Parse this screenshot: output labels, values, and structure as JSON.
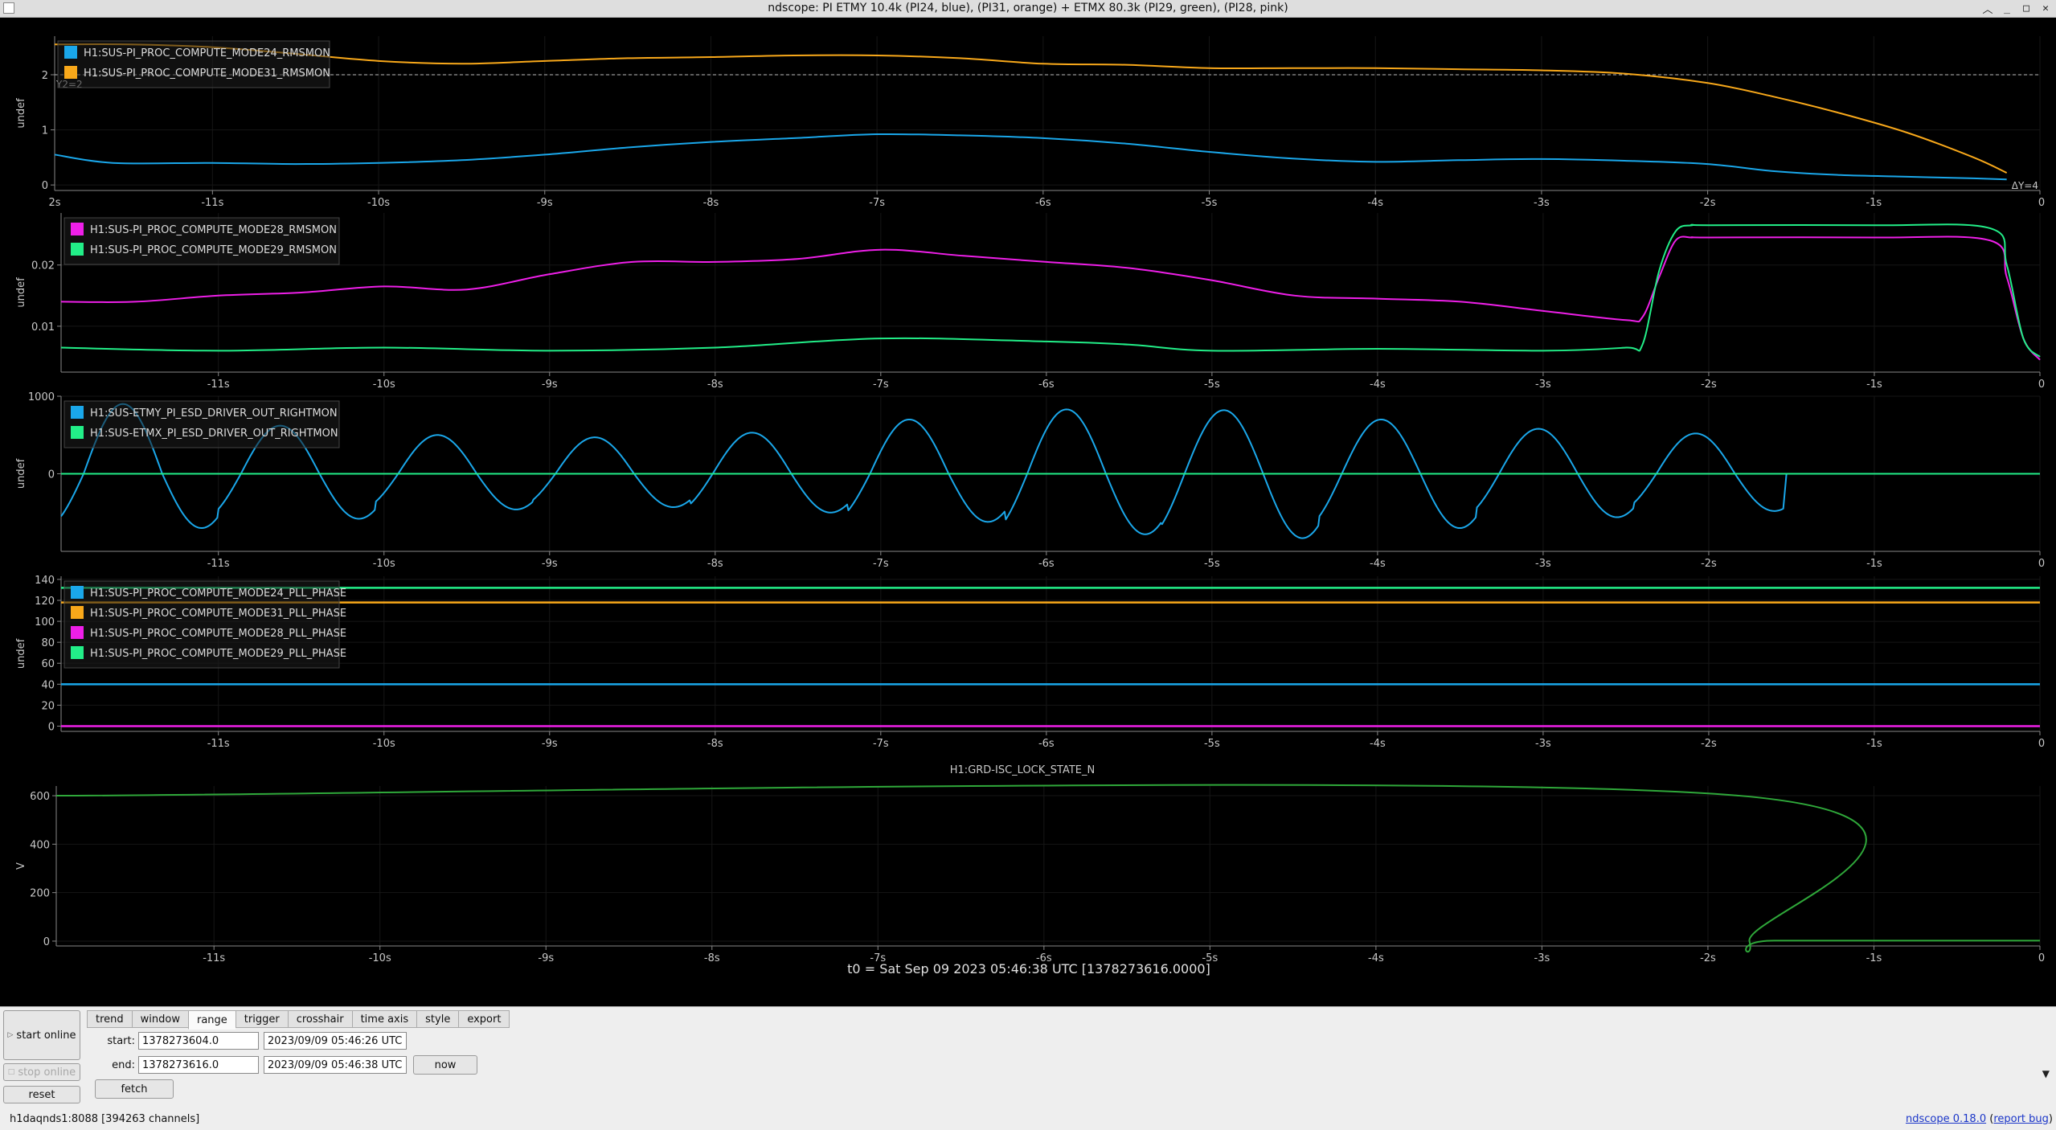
{
  "window": {
    "title": "ndscope: PI ETMY 10.4k (PI24, blue), (PI31, orange) + ETMX 80.3k (PI29, green), (PI28, pink)"
  },
  "colors": {
    "blue": "#1aa7ea",
    "orange": "#f8a81a",
    "pink": "#ee1fe8",
    "green": "#22ee88",
    "guardian": "#2fa83a",
    "background": "#000000",
    "axis_text": "#c8c8c8"
  },
  "x_axis": {
    "ticks": [
      -11,
      -10,
      -9,
      -8,
      -7,
      -6,
      -5,
      -4,
      -3,
      -2,
      -1,
      0
    ],
    "tick_labels": [
      "-11s",
      "-10s",
      "-9s",
      "-8s",
      "-7s",
      "-6s",
      "-5s",
      "-4s",
      "-3s",
      "-2s",
      "-1s",
      "0"
    ],
    "first_plot_left_label": "2s",
    "range": [
      -11.95,
      0
    ]
  },
  "t0_label": "t0 = Sat Sep 09 2023 05:46:38 UTC [1378273616.0000]",
  "chart_data": [
    {
      "type": "line",
      "ylabel": "undef",
      "yticks": [
        0,
        1,
        2
      ],
      "ylim": [
        -0.1,
        2.7
      ],
      "cursor_y": 2.0,
      "cursor_label": "Y2=2",
      "delta_label": "ΔY=4",
      "series": [
        {
          "name": "H1:SUS-PI_PROC_COMPUTE_MODE24_RMSMON",
          "color": "blue",
          "x": [
            -11.95,
            -11.6,
            -11.0,
            -10.5,
            -10.0,
            -9.5,
            -9.0,
            -8.5,
            -8.0,
            -7.5,
            -7.0,
            -6.5,
            -6.0,
            -5.5,
            -5.0,
            -4.5,
            -4.0,
            -3.5,
            -3.0,
            -2.5,
            -2.0,
            -1.6,
            -1.2,
            -0.8,
            -0.4,
            -0.2
          ],
          "y": [
            0.55,
            0.4,
            0.4,
            0.38,
            0.4,
            0.45,
            0.55,
            0.68,
            0.78,
            0.85,
            0.92,
            0.9,
            0.85,
            0.75,
            0.6,
            0.48,
            0.42,
            0.45,
            0.47,
            0.44,
            0.38,
            0.25,
            0.18,
            0.15,
            0.12,
            0.1
          ]
        },
        {
          "name": "H1:SUS-PI_PROC_COMPUTE_MODE31_RMSMON",
          "color": "orange",
          "x": [
            -11.95,
            -11.5,
            -11.0,
            -10.5,
            -10.0,
            -9.5,
            -9.0,
            -8.5,
            -8.0,
            -7.5,
            -7.0,
            -6.5,
            -6.0,
            -5.5,
            -5.0,
            -4.5,
            -4.0,
            -3.5,
            -3.0,
            -2.5,
            -2.0,
            -1.6,
            -1.2,
            -0.8,
            -0.4,
            -0.2
          ],
          "y": [
            2.55,
            2.55,
            2.5,
            2.38,
            2.25,
            2.2,
            2.25,
            2.3,
            2.32,
            2.35,
            2.35,
            2.3,
            2.2,
            2.18,
            2.12,
            2.12,
            2.12,
            2.1,
            2.08,
            2.02,
            1.85,
            1.6,
            1.3,
            0.95,
            0.5,
            0.22
          ]
        }
      ]
    },
    {
      "type": "line",
      "ylabel": "undef",
      "yticks": [
        0.01,
        0.02
      ],
      "ytick_labels": [
        "0.01",
        "0.02"
      ],
      "ylim": [
        0.0025,
        0.0285
      ],
      "series": [
        {
          "name": "H1:SUS-PI_PROC_COMPUTE_MODE28_RMSMON",
          "color": "pink",
          "x": [
            -11.95,
            -11.5,
            -11.0,
            -10.5,
            -10.0,
            -9.5,
            -9.0,
            -8.5,
            -8.0,
            -7.5,
            -7.0,
            -6.5,
            -6.0,
            -5.5,
            -5.0,
            -4.5,
            -4.0,
            -3.5,
            -3.0,
            -2.5,
            -2.4,
            -2.3,
            -2.2,
            -2.1,
            -2.0,
            -1.0,
            -0.3,
            -0.2,
            -0.1,
            0.0
          ],
          "y": [
            0.014,
            0.014,
            0.015,
            0.0155,
            0.0165,
            0.016,
            0.0185,
            0.0205,
            0.0205,
            0.021,
            0.0225,
            0.0215,
            0.0205,
            0.0195,
            0.0175,
            0.015,
            0.0145,
            0.014,
            0.0125,
            0.011,
            0.0115,
            0.018,
            0.024,
            0.0245,
            0.0245,
            0.0245,
            0.024,
            0.018,
            0.008,
            0.0045
          ]
        },
        {
          "name": "H1:SUS-PI_PROC_COMPUTE_MODE29_RMSMON",
          "color": "green",
          "x": [
            -11.95,
            -11.0,
            -10.0,
            -9.0,
            -8.0,
            -7.0,
            -6.0,
            -5.5,
            -5.0,
            -4.0,
            -3.0,
            -2.5,
            -2.4,
            -2.3,
            -2.2,
            -2.1,
            -2.0,
            -1.0,
            -0.3,
            -0.2,
            -0.1,
            0.0
          ],
          "y": [
            0.0065,
            0.006,
            0.0065,
            0.006,
            0.0065,
            0.008,
            0.0075,
            0.007,
            0.006,
            0.0063,
            0.006,
            0.0065,
            0.007,
            0.019,
            0.0255,
            0.0265,
            0.0265,
            0.0265,
            0.026,
            0.02,
            0.008,
            0.005
          ]
        }
      ]
    },
    {
      "type": "line",
      "ylabel": "undef",
      "yticks": [
        0,
        1000
      ],
      "ylim": [
        -1000,
        1000
      ],
      "series": [
        {
          "name": "H1:SUS-ETMY_PI_ESD_DRIVER_OUT_RIGHTMON",
          "color": "blue",
          "wave": {
            "start": -11.95,
            "end": -1.55,
            "oscillations": [
              {
                "peak": 900,
                "trough": -700
              },
              {
                "peak": 620,
                "trough": -580
              },
              {
                "peak": 500,
                "trough": -460
              },
              {
                "peak": 470,
                "trough": -430
              },
              {
                "peak": 530,
                "trough": -500
              },
              {
                "peak": 700,
                "trough": -620
              },
              {
                "peak": 830,
                "trough": -780
              },
              {
                "peak": 820,
                "trough": -830
              },
              {
                "peak": 700,
                "trough": -700
              },
              {
                "peak": 580,
                "trough": -560
              },
              {
                "peak": 520,
                "trough": -480
              }
            ]
          }
        },
        {
          "name": "H1:SUS-ETMX_PI_ESD_DRIVER_OUT_RIGHTMON",
          "color": "green",
          "x": [
            -11.95,
            0
          ],
          "y": [
            0,
            0
          ]
        }
      ]
    },
    {
      "type": "line",
      "ylabel": "undef",
      "yticks": [
        0,
        20,
        40,
        60,
        80,
        100,
        120,
        140
      ],
      "ylim": [
        -5,
        143
      ],
      "series": [
        {
          "name": "H1:SUS-PI_PROC_COMPUTE_MODE24_PLL_PHASE",
          "color": "blue",
          "x": [
            -11.95,
            0
          ],
          "y": [
            40,
            40
          ]
        },
        {
          "name": "H1:SUS-PI_PROC_COMPUTE_MODE31_PLL_PHASE",
          "color": "orange",
          "x": [
            -11.95,
            0
          ],
          "y": [
            118,
            118
          ]
        },
        {
          "name": "H1:SUS-PI_PROC_COMPUTE_MODE28_PLL_PHASE",
          "color": "pink",
          "x": [
            -11.95,
            0
          ],
          "y": [
            0,
            0
          ]
        },
        {
          "name": "H1:SUS-PI_PROC_COMPUTE_MODE29_PLL_PHASE",
          "color": "green",
          "x": [
            -11.95,
            0
          ],
          "y": [
            132,
            132
          ]
        }
      ]
    },
    {
      "type": "line",
      "title": "H1:GRD-ISC_LOCK_STATE_N",
      "ylabel": "V",
      "yticks": [
        0,
        200,
        400,
        600
      ],
      "ylim": [
        -20,
        640
      ],
      "series": [
        {
          "color": "guardian",
          "x": [
            -11.95,
            -1.81,
            -1.75,
            -1.6,
            0
          ],
          "y": [
            600,
            600,
            0,
            2,
            2
          ]
        }
      ]
    }
  ],
  "controls": {
    "start_online": "start online",
    "stop_online": "stop online",
    "reset": "reset",
    "fetch": "fetch",
    "now": "now",
    "tabs": [
      "trend",
      "window",
      "range",
      "trigger",
      "crosshair",
      "time axis",
      "style",
      "export"
    ],
    "active_tab": "range",
    "start_label": "start:",
    "start_gps": "1378273604.0",
    "start_utc": "2023/09/09 05:46:26 UTC",
    "end_label": "end:",
    "end_gps": "1378273616.0",
    "end_utc": "2023/09/09 05:46:38 UTC"
  },
  "status": {
    "server": "h1daqnds1:8088  [394263 channels]",
    "version": "ndscope 0.18.0",
    "report": "report bug"
  }
}
